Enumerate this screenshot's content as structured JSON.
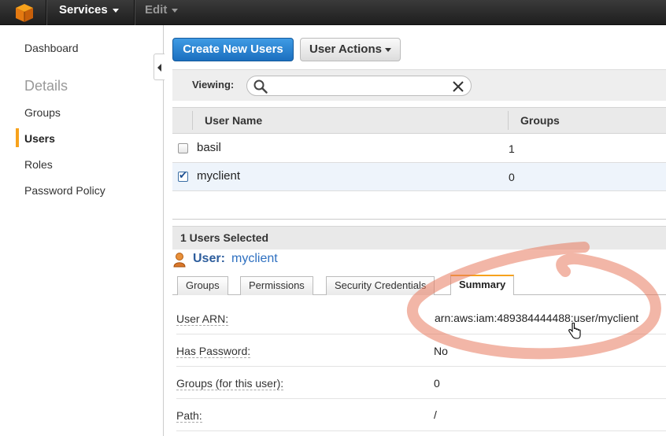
{
  "topbar": {
    "services_label": "Services",
    "edit_label": "Edit",
    "logo_icon": "aws-cube-icon",
    "accent_color": "#f7a21c"
  },
  "sidebar": {
    "items": [
      {
        "label": "Dashboard",
        "active": false
      },
      {
        "label": "Groups",
        "active": false
      },
      {
        "label": "Users",
        "active": true
      },
      {
        "label": "Roles",
        "active": false
      },
      {
        "label": "Password Policy",
        "active": false
      }
    ],
    "section_heading": "Details"
  },
  "toolbar": {
    "create_label": "Create New Users",
    "actions_label": "User Actions"
  },
  "filter": {
    "label": "Viewing:",
    "value": "",
    "placeholder": ""
  },
  "table": {
    "columns": [
      "User Name",
      "Groups"
    ],
    "rows": [
      {
        "name": "basil",
        "groups": "1",
        "checked": false
      },
      {
        "name": "myclient",
        "groups": "0",
        "checked": true
      }
    ]
  },
  "details": {
    "selected_count_label": "1 Users Selected",
    "user_prefix": "User:",
    "user_name": "myclient",
    "tabs": [
      "Groups",
      "Permissions",
      "Security Credentials",
      "Summary"
    ],
    "active_tab": "Summary",
    "fields": [
      {
        "label": "User ARN:",
        "value": "arn:aws:iam:489384444488:user/myclient"
      },
      {
        "label": "Has Password:",
        "value": "No"
      },
      {
        "label": "Groups (for this user):",
        "value": "0"
      },
      {
        "label": "Path:",
        "value": "/"
      }
    ]
  },
  "colors": {
    "primary_button": "#1b6fbf",
    "annotation_circle": "#e87a5e",
    "link": "#2d6fc0"
  }
}
